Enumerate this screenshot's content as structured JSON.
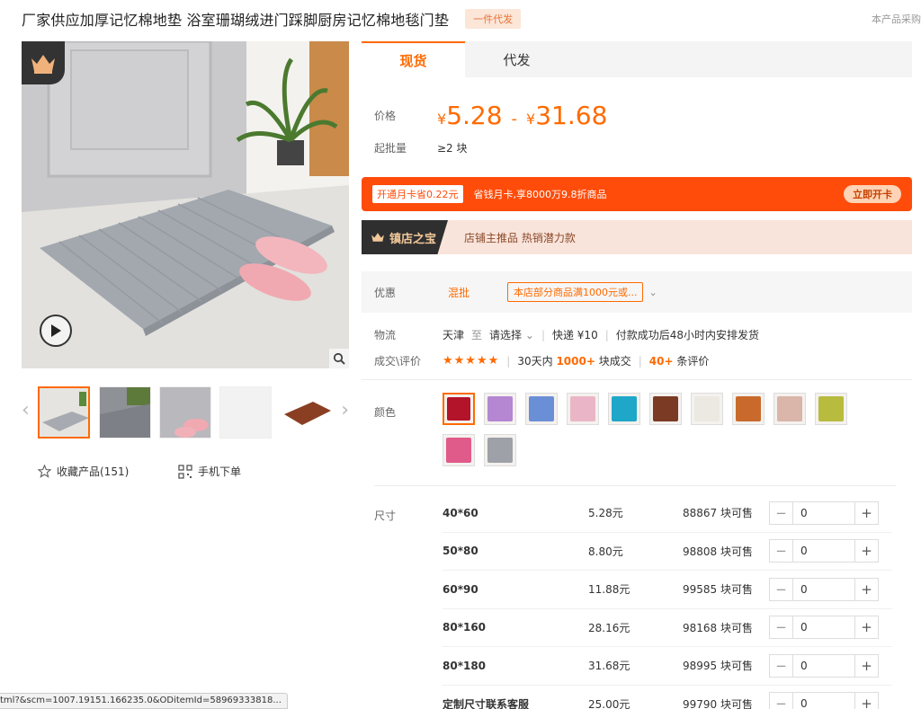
{
  "header": {
    "title": "厂家供应加厚记忆棉地垫 浴室珊瑚绒进门踩脚厨房记忆棉地毯门垫",
    "badge": "一件代发",
    "note": "本产品采购"
  },
  "gallery": {
    "main_image_desc": "grey bath mat with pink slippers",
    "thumbnails": [
      {
        "color": "#a7abb1"
      },
      {
        "color": "#8e9196"
      },
      {
        "color": "#b9b8bd"
      },
      {
        "color": "#f2f2f2"
      },
      {
        "color": "#8a3f22"
      }
    ],
    "favorite_label": "收藏产品(151)",
    "mobile_label": "手机下单"
  },
  "tabs": [
    {
      "label": "现货"
    },
    {
      "label": "代发"
    }
  ],
  "price": {
    "label": "价格",
    "currency": "¥",
    "min": "5.28",
    "max": "31.68",
    "dash": "-",
    "moq_label": "起批量",
    "moq_value": "≥2 块"
  },
  "promo": {
    "tag": "开通月卡省0.22元",
    "text": "省钱月卡,享8000万9.8折商品",
    "button": "立即开卡"
  },
  "store": {
    "badge": "镇店之宝",
    "text": "店铺主推品  热销潜力款"
  },
  "discount": {
    "label": "优惠",
    "mix": "混批",
    "coupon": "本店部分商品满1000元或...",
    "chevron": "⌄"
  },
  "logistics": {
    "label": "物流",
    "origin": "天津",
    "to": "至",
    "select": "请选择",
    "express": "快递 ¥10",
    "ship_note": "付款成功后48小时内安排发货"
  },
  "reviews": {
    "label": "成交\\评价",
    "stars": "★★★★★",
    "sales_prefix": "30天内",
    "sales_count": "1000+",
    "sales_suffix": "块成交",
    "review_count": "40+",
    "review_suffix": "条评价"
  },
  "colors": {
    "label": "颜色",
    "swatches": [
      {
        "color": "#b3142a"
      },
      {
        "color": "#b586d1"
      },
      {
        "color": "#6a8fd6"
      },
      {
        "color": "#eab6c7"
      },
      {
        "color": "#1ea7c9"
      },
      {
        "color": "#7a3a24"
      },
      {
        "color": "#ece9e2"
      },
      {
        "color": "#c96a2c"
      },
      {
        "color": "#d9b5aa"
      },
      {
        "color": "#b7bb3e"
      },
      {
        "color": "#e05a8a"
      },
      {
        "color": "#9ea1a7"
      }
    ]
  },
  "sizes": {
    "label": "尺寸",
    "rows": [
      {
        "name": "40*60",
        "price": "5.28元",
        "stock": "88867 块可售",
        "qty": "0"
      },
      {
        "name": "50*80",
        "price": "8.80元",
        "stock": "98808 块可售",
        "qty": "0"
      },
      {
        "name": "60*90",
        "price": "11.88元",
        "stock": "99585 块可售",
        "qty": "0"
      },
      {
        "name": "80*160",
        "price": "28.16元",
        "stock": "98168 块可售",
        "qty": "0"
      },
      {
        "name": "80*180",
        "price": "31.68元",
        "stock": "98995 块可售",
        "qty": "0"
      },
      {
        "name": "定制尺寸联系客服",
        "price": "25.00元",
        "stock": "99790 块可售",
        "qty": "0"
      }
    ]
  },
  "statusbar": {
    "url": "tml?&scm=1007.19151.166235.0&ODitemId=58969333818..."
  }
}
